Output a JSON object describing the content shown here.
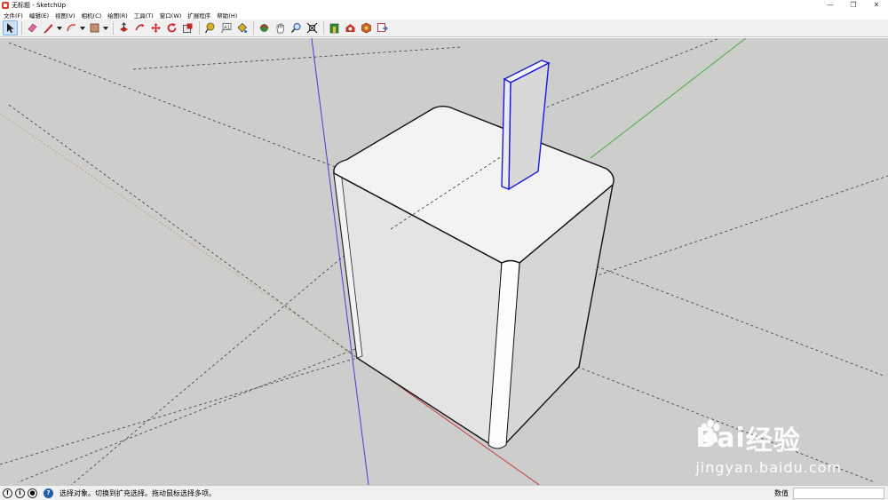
{
  "window": {
    "title": "无标题 - SketchUp",
    "controls": [
      "—",
      "❐",
      "✕"
    ]
  },
  "menu": [
    {
      "label": "文件(F)"
    },
    {
      "label": "编辑(E)"
    },
    {
      "label": "视图(V)"
    },
    {
      "label": "相机(C)"
    },
    {
      "label": "绘图(R)"
    },
    {
      "label": "工具(T)"
    },
    {
      "label": "窗口(W)"
    },
    {
      "label": "扩展程序"
    },
    {
      "label": "帮助(H)"
    }
  ],
  "toolbar": {
    "tools": [
      {
        "icon": "select-arrow-icon",
        "color": "#1a1a1a",
        "active": true
      },
      {
        "icon": "eraser-icon",
        "color": "#e06aa0"
      },
      {
        "icon": "pencil-line-icon",
        "color": "#c0262c"
      },
      {
        "icon": "arc-icon",
        "color": "#d83a2a"
      },
      {
        "icon": "rectangle-icon",
        "color": "#a05a3a"
      },
      {
        "icon": "push-pull-icon",
        "color": "#b03020"
      },
      {
        "icon": "follow-me-icon",
        "color": "#c03030"
      },
      {
        "icon": "move-icon",
        "color": "#d02828"
      },
      {
        "icon": "rotate-icon",
        "color": "#d02828"
      },
      {
        "icon": "scale-icon",
        "color": "#c02828"
      },
      {
        "icon": "tape-measure-icon",
        "color": "#c8a020"
      },
      {
        "icon": "text-label-icon",
        "color": "#555555"
      },
      {
        "icon": "paint-bucket-icon",
        "color": "#d8b030"
      },
      {
        "icon": "orbit-icon",
        "color": "#c02828"
      },
      {
        "icon": "pan-hand-icon",
        "color": "#555555"
      },
      {
        "icon": "zoom-magnifier-icon",
        "color": "#3a6ab0"
      },
      {
        "icon": "zoom-extents-icon",
        "color": "#2a2a2a"
      },
      {
        "icon": "warehouse-icon",
        "color": "#3a8a3a"
      },
      {
        "icon": "extension-warehouse-icon",
        "color": "#c03028"
      },
      {
        "icon": "components-icon",
        "color": "#d06020"
      },
      {
        "icon": "send-to-layout-icon",
        "color": "#c02848"
      }
    ]
  },
  "viewport": {
    "background": "#cdcdcb",
    "axis_colors": {
      "red": "#c04040",
      "green": "#40b040",
      "blue": "#4040d0"
    }
  },
  "watermark": {
    "brand_left": "Bai",
    "brand_right": "经验",
    "url": "jingyan.baidu.com"
  },
  "statusbar": {
    "message": "选择对象。切换到扩充选择。拖动鼠标选择多项。",
    "measurements_label": "数值",
    "measurements_value": ""
  }
}
